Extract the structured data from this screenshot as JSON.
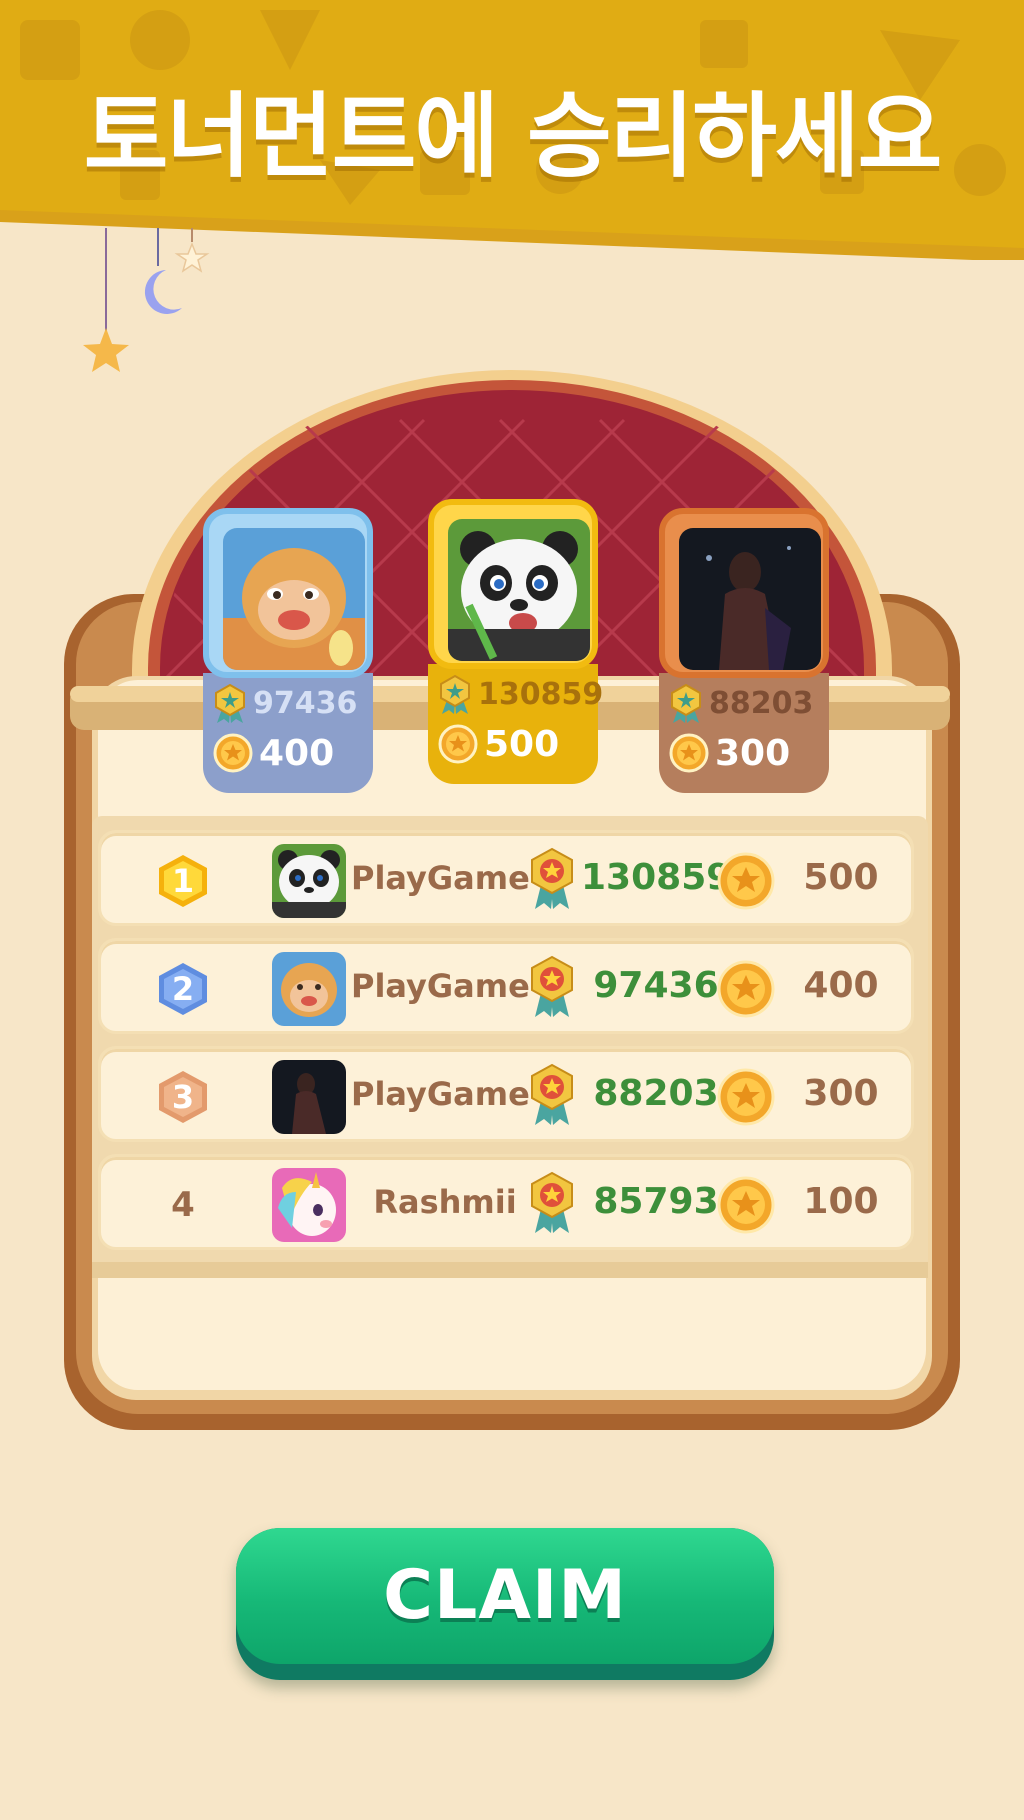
{
  "banner": {
    "title": "토너먼트에 승리하세요"
  },
  "podium": [
    {
      "position": "second",
      "avatar": "monkey-avatar",
      "trophies": "97436",
      "coins": "400"
    },
    {
      "position": "first",
      "avatar": "panda-avatar",
      "trophies": "130859",
      "coins": "500"
    },
    {
      "position": "third",
      "avatar": "photo-avatar",
      "trophies": "88203",
      "coins": "300"
    }
  ],
  "rankings": [
    {
      "rank": "1",
      "avatar": "panda-avatar",
      "name": "PlayGame",
      "score": "130859",
      "reward": "500"
    },
    {
      "rank": "2",
      "avatar": "monkey-avatar",
      "name": "PlayGame",
      "score": "97436",
      "reward": "400"
    },
    {
      "rank": "3",
      "avatar": "photo-avatar",
      "name": "PlayGame",
      "score": "88203",
      "reward": "300"
    },
    {
      "rank": "4",
      "avatar": "unicorn-avatar",
      "name": "Rashmii",
      "score": "85793",
      "reward": "100"
    }
  ],
  "claim_button": {
    "label": "CLAIM"
  },
  "colors": {
    "background": "#f7e6c8",
    "banner": "#e0ac14",
    "gold": "#e8b20c",
    "silver": "#8c9fcb",
    "bronze": "#b57e5d",
    "score_green": "#3d8f3a",
    "claim_green": "#16b877"
  }
}
